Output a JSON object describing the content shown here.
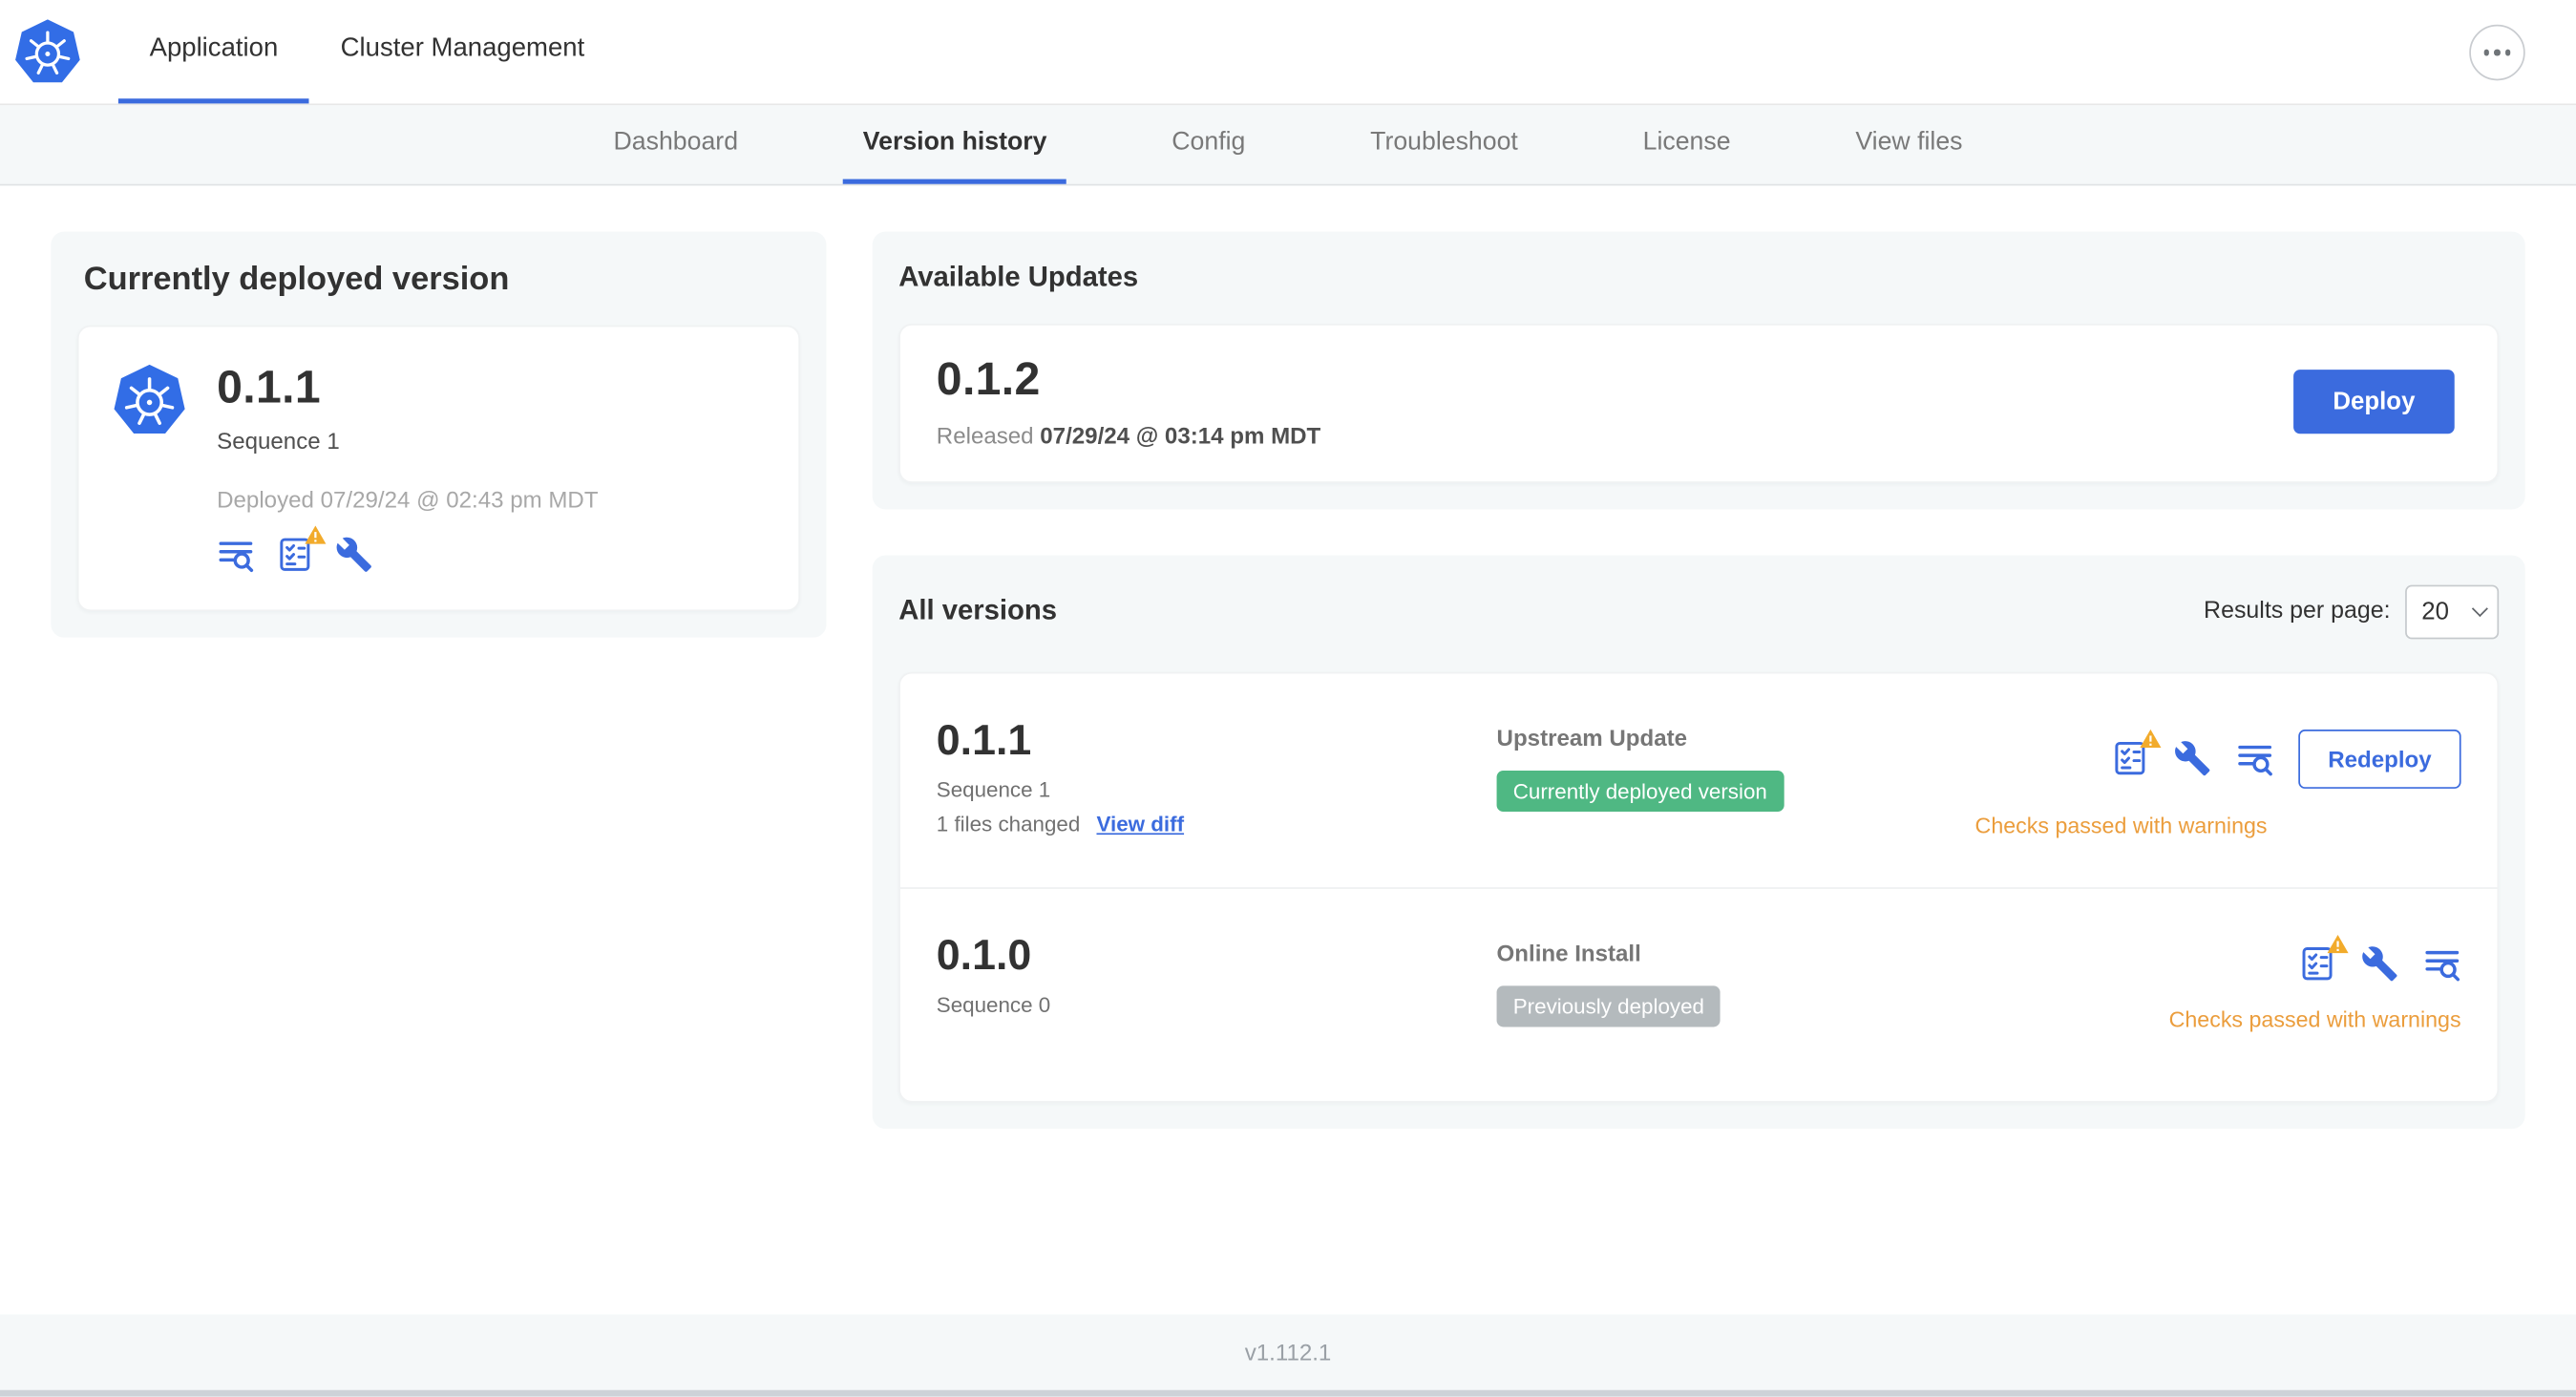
{
  "top_nav": {
    "tabs": [
      {
        "label": "Application",
        "active": true
      },
      {
        "label": "Cluster Management",
        "active": false
      }
    ]
  },
  "sub_nav": {
    "tabs": [
      "Dashboard",
      "Version history",
      "Config",
      "Troubleshoot",
      "License",
      "View files"
    ],
    "active": "Version history"
  },
  "current_version": {
    "title": "Currently deployed version",
    "version": "0.1.1",
    "sequence": "Sequence 1",
    "deployed": "Deployed 07/29/24 @ 02:43 pm MDT"
  },
  "available_updates": {
    "title": "Available Updates",
    "version": "0.1.2",
    "released_prefix": "Released",
    "released_date": "07/29/24 @ 03:14 pm MDT",
    "deploy_label": "Deploy"
  },
  "all_versions": {
    "title": "All versions",
    "results_per_page_label": "Results per page:",
    "results_per_page": "20",
    "rows": [
      {
        "version": "0.1.1",
        "sequence": "Sequence 1",
        "files_changed": "1 files changed",
        "view_diff_label": "View diff",
        "source": "Upstream Update",
        "status_badge": "Currently deployed version",
        "badge_type": "green",
        "checks_text": "Checks passed with warnings",
        "action_label": "Redeploy"
      },
      {
        "version": "0.1.0",
        "sequence": "Sequence 0",
        "source": "Online Install",
        "status_badge": "Previously deployed",
        "badge_type": "gray",
        "checks_text": "Checks passed with warnings"
      }
    ]
  },
  "footer": {
    "version": "v1.112.1"
  },
  "icons": {
    "app_logo": "kubernetes-helm-wheel",
    "overflow_menu": "ellipsis-circle",
    "release_notes": "text-lines-magnifier",
    "preflight_checks": "checklist-with-warning-triangle",
    "edit_config": "wrench",
    "results_dropdown": "chevron-down"
  },
  "colors": {
    "k8s_blue": "#326de6",
    "primary_blue": "#3b6bde",
    "success_green": "#4fb883",
    "neutral_gray_badge": "#b4babd",
    "warning_text": "#eb9d3c",
    "warning_triangle": "#f2ab2b"
  }
}
